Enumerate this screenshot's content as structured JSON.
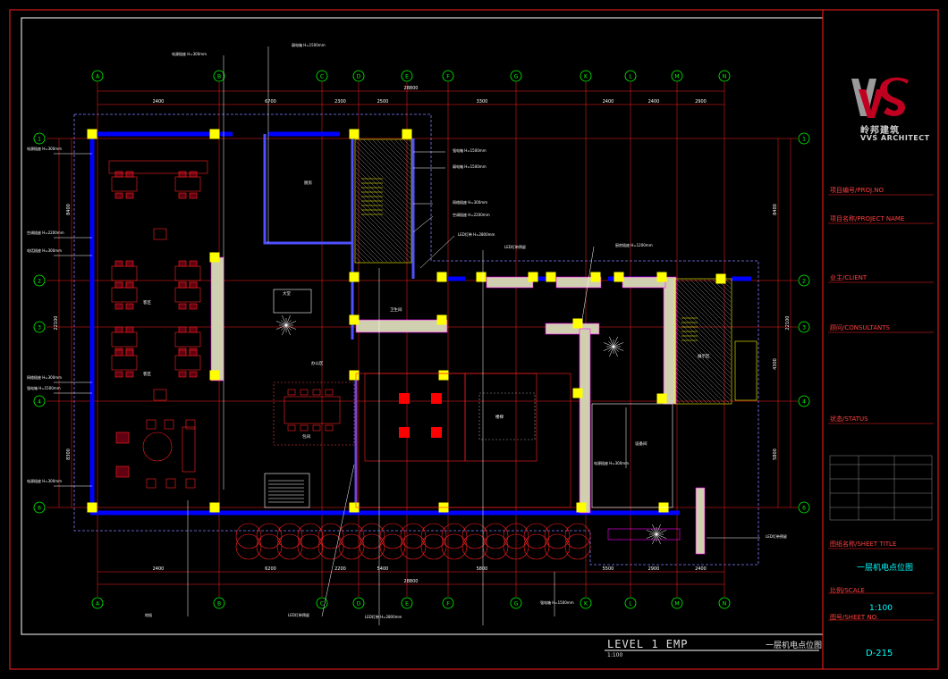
{
  "drawing": {
    "title": "LEVEL 1  EMP",
    "title_cn": "一层机电点位图",
    "title_scale": "1:100"
  },
  "title_block": {
    "brand_cn": "岭邦建筑",
    "brand_en": "VVS ARCHITECT",
    "fields": [
      {
        "key": "project_no",
        "label": "项目编号/PROJ.NO"
      },
      {
        "key": "project_name",
        "label": "项目名称/PROJECT NAME"
      },
      {
        "key": "client",
        "label": "业主/CLIENT"
      },
      {
        "key": "consultants",
        "label": "顾问/CONSULTANTS"
      },
      {
        "key": "status",
        "label": "状态/STATUS"
      },
      {
        "key": "sheet_title",
        "label": "图纸名称/SHEET TITLE"
      },
      {
        "key": "scale",
        "label": "比例/SCALE"
      },
      {
        "key": "sheet_no",
        "label": "图号/SHEET NO."
      }
    ],
    "sheet_title_value": "一层机电点位图",
    "scale_value": "1:100",
    "sheet_no_value": "D-215"
  },
  "grid": {
    "column_labels": [
      "A",
      "B",
      "C",
      "D",
      "E",
      "F",
      "G",
      "K",
      "L",
      "M",
      "N"
    ],
    "row_labels": [
      "1",
      "2",
      "3",
      "4",
      "6"
    ],
    "top_dims": [
      "2400",
      "6700",
      "2300",
      "2500",
      "",
      "3300",
      "",
      "2400",
      "2400",
      "2900"
    ],
    "top_total": "28800",
    "bottom_dims": [
      "2400",
      "6200",
      "2200",
      "5400",
      "",
      "5800",
      "",
      "5500",
      "2900",
      "2400"
    ],
    "bottom_total": "28800",
    "left_dims": [
      "8400",
      "",
      "8300"
    ],
    "left_total": "22100",
    "right_dims": [
      "8400",
      "",
      "4300",
      "5800"
    ],
    "right_total": "22100"
  },
  "room_labels": [
    "客区",
    "客区",
    "厨房",
    "卫生间",
    "大堂",
    "办公区",
    "包间",
    "楼梯",
    "设备间",
    "展示区"
  ],
  "annotations": [
    "电源插座 H=300mm",
    "强电箱 H=1500mm",
    "弱电箱 H=1500mm",
    "LED灯带 H=2800mm",
    "网络插座 H=300mm",
    "电话插座 H=300mm",
    "空调插座 H=2200mm",
    "LED灯带预留",
    "地插",
    "厨房插座 H=1200mm"
  ]
}
